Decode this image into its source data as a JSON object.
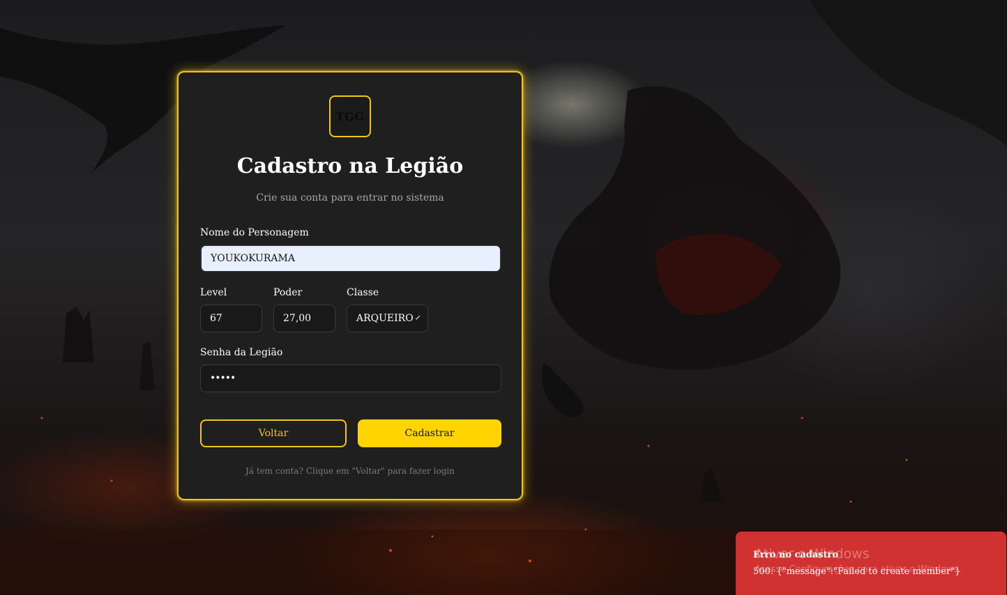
{
  "form": {
    "logo_text": "TGG",
    "title": "Cadastro na Legião",
    "subtitle": "Crie sua conta para entrar no sistema",
    "name_label": "Nome do Personagem",
    "name_value": "YOUKOKURAMA",
    "level_label": "Level",
    "level_value": "67",
    "power_label": "Poder",
    "power_value": "27,00",
    "class_label": "Classe",
    "class_value": "ARQUEIRO",
    "password_label": "Senha da Legião",
    "password_value": "•••••",
    "back_label": "Voltar",
    "submit_label": "Cadastrar",
    "hint": "Já tem conta? Clique em \"Voltar\" para fazer login"
  },
  "toast": {
    "title": "Erro no cadastro",
    "message": "500: {\"message\":\"Failed to create member\"}"
  },
  "watermark": {
    "line1": "Ativar o Windows",
    "line2": "Acesse Configurações para ativar o Windows."
  },
  "colors": {
    "accent": "#f3c514",
    "submit": "#ffd400",
    "error": "#d03131"
  }
}
